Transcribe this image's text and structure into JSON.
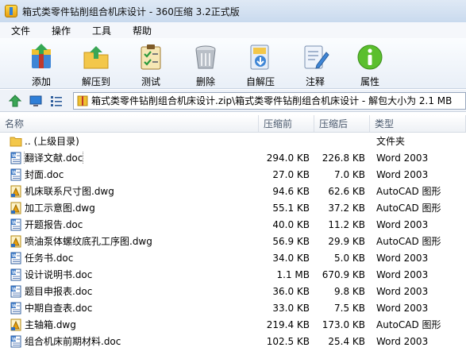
{
  "window": {
    "title": "箱式类零件钻削组合机床设计 - 360压缩 3.2正式版"
  },
  "menu": [
    "文件",
    "操作",
    "工具",
    "帮助"
  ],
  "toolbar": {
    "buttons": [
      {
        "label": "添加",
        "icon": "add-archive-icon"
      },
      {
        "label": "解压到",
        "icon": "extract-to-icon"
      },
      {
        "label": "测试",
        "icon": "test-clipboard-icon"
      },
      {
        "label": "删除",
        "icon": "trash-can-icon"
      },
      {
        "label": "自解压",
        "icon": "self-extract-icon"
      },
      {
        "label": "注释",
        "icon": "comment-pen-icon"
      },
      {
        "label": "属性",
        "icon": "info-icon"
      }
    ]
  },
  "address": {
    "path": "箱式类零件钻削组合机床设计.zip\\箱式类零件钻削组合机床设计 - 解包大小为 2.1 MB"
  },
  "columns": {
    "name": "名称",
    "size": "压缩前",
    "packed": "压缩后",
    "type": "类型"
  },
  "files": [
    {
      "name": ".. (上级目录)",
      "size": "",
      "packed": "",
      "type": "文件夹",
      "kind": "folder"
    },
    {
      "name": "翻译文献.doc",
      "size": "294.0 KB",
      "packed": "226.8 KB",
      "type": "Word 2003",
      "kind": "doc"
    },
    {
      "name": "封面.doc",
      "size": "27.0 KB",
      "packed": "7.0 KB",
      "type": "Word 2003",
      "kind": "doc"
    },
    {
      "name": "机床联系尺寸图.dwg",
      "size": "94.6 KB",
      "packed": "62.6 KB",
      "type": "AutoCAD 图形",
      "kind": "dwg"
    },
    {
      "name": "加工示意图.dwg",
      "size": "55.1 KB",
      "packed": "37.2 KB",
      "type": "AutoCAD 图形",
      "kind": "dwg"
    },
    {
      "name": "开题报告.doc",
      "size": "40.0 KB",
      "packed": "11.2 KB",
      "type": "Word 2003",
      "kind": "doc"
    },
    {
      "name": "喷油泵体螺纹底孔工序图.dwg",
      "size": "56.9 KB",
      "packed": "29.9 KB",
      "type": "AutoCAD 图形",
      "kind": "dwg"
    },
    {
      "name": "任务书.doc",
      "size": "34.0 KB",
      "packed": "5.0 KB",
      "type": "Word 2003",
      "kind": "doc"
    },
    {
      "name": "设计说明书.doc",
      "size": "1.1 MB",
      "packed": "670.9 KB",
      "type": "Word 2003",
      "kind": "doc"
    },
    {
      "name": "题目申报表.doc",
      "size": "36.0 KB",
      "packed": "9.8 KB",
      "type": "Word 2003",
      "kind": "doc"
    },
    {
      "name": "中期自查表.doc",
      "size": "33.0 KB",
      "packed": "7.5 KB",
      "type": "Word 2003",
      "kind": "doc"
    },
    {
      "name": "主轴箱.dwg",
      "size": "219.4 KB",
      "packed": "173.0 KB",
      "type": "AutoCAD 图形",
      "kind": "dwg"
    },
    {
      "name": "组合机床前期材料.doc",
      "size": "102.5 KB",
      "packed": "25.4 KB",
      "type": "Word 2003",
      "kind": "doc"
    }
  ]
}
